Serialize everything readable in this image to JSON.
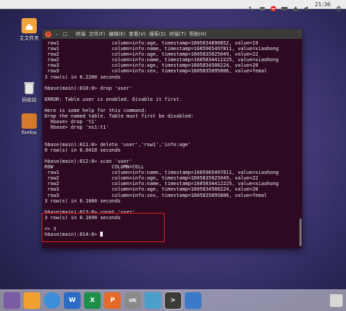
{
  "top_panel": {
    "clock": "21:36",
    "icons": [
      "arrows-icon",
      "dropbox-icon",
      "stop-icon",
      "keyboard-icon",
      "network-icon",
      "volume-icon",
      "power-icon"
    ]
  },
  "desktop": {
    "icons": [
      {
        "name": "主文件夹",
        "icon": "home-folder-icon"
      },
      {
        "name": "回收站",
        "icon": "trash-icon"
      },
      {
        "name": "firefox",
        "icon": "firefox-icon"
      }
    ]
  },
  "terminal": {
    "menu": [
      "终端",
      "文件(F)",
      "编辑(E)",
      "查看(V)",
      "搜索(S)",
      "终端(T)",
      "帮助(H)"
    ],
    "lines": [
      " row1                  column=info:age, timestamp=1605834890852, value=19",
      " row1                  column=info:name, timestamp=1605965497811, value=xiaohong",
      " row2                  column=info:age, timestamp=1605835025049, value=22",
      " row2                  column=info:name, timestamp=1605834412225, value=xiaohong",
      " row3                  column=info:age, timestamp=1605834508224, value=20",
      " row3                  column=info:sex, timestamp=1605835095806, value=femal",
      "3 row(s) in 0.2200 seconds",
      "",
      "hbase(main):010:0> drop 'user'",
      "",
      "ERROR: Table user is enabled. Disable it first.",
      "",
      "Here is some help for this command:",
      "Drop the named table. Table must first be disabled:",
      "  hbase> drop 't1'",
      "  hbase> drop 'ns1:t1'",
      "",
      "",
      "hbase(main):011:0> delete 'user','row1','info:age'",
      "0 row(s) in 0.0410 seconds",
      "",
      "hbase(main):012:0> scan 'user'",
      "ROW                    COLUMN+CELL",
      " row1                  column=info:name, timestamp=1605965497811, value=xiaohong",
      " row2                  column=info:age, timestamp=1605835025049, value=22",
      " row2                  column=info:name, timestamp=1605834412225, value=xiaohong",
      " row3                  column=info:age, timestamp=1605834508224, value=20",
      " row3                  column=info:sex, timestamp=1605835095806, value=femal",
      "3 row(s) in 0.1000 seconds",
      "",
      "hbase(main):013:0> count 'user'",
      "3 row(s) in 0.1690 seconds",
      "",
      "=> 3",
      "hbase(main):014:0> "
    ]
  },
  "dock": {
    "items": [
      {
        "name": "ubuntu-icon",
        "label": "",
        "color": "#7b5ba6"
      },
      {
        "name": "files-icon",
        "label": "",
        "color": "#f0a030"
      },
      {
        "name": "browser-icon",
        "label": "",
        "color": "#3a8fd8"
      },
      {
        "name": "word-icon",
        "label": "W",
        "color": "#2b6cc4"
      },
      {
        "name": "excel-icon",
        "label": "X",
        "color": "#1e8e4a"
      },
      {
        "name": "powerpoint-icon",
        "label": "P",
        "color": "#e46a2a"
      },
      {
        "name": "uk-icon",
        "label": "UK",
        "color": "#8a8a8a"
      },
      {
        "name": "mail-icon",
        "label": "",
        "color": "#4aa0c8"
      },
      {
        "name": "terminal-icon",
        "label": ">",
        "color": "#3c3b37"
      },
      {
        "name": "screen-icon",
        "label": "",
        "color": "#3a7ac8"
      }
    ]
  }
}
